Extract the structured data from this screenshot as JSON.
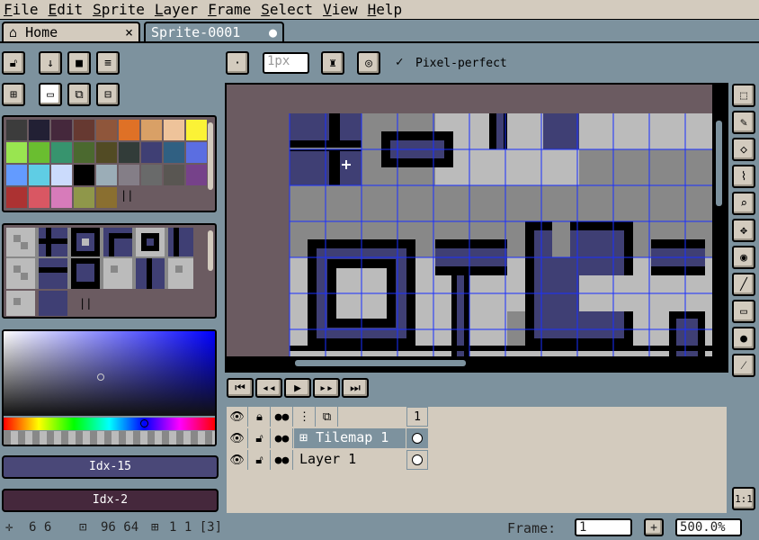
{
  "menu": [
    "File",
    "Edit",
    "Sprite",
    "Layer",
    "Frame",
    "Select",
    "View",
    "Help"
  ],
  "tabs": {
    "home": {
      "label": "Home",
      "close": "×"
    },
    "sprite": {
      "label": "Sprite-0001",
      "modified": "●"
    }
  },
  "toolbar": {
    "brush_size": "1px",
    "pixel_perfect_label": "Pixel-perfect",
    "pixel_perfect_checked": true
  },
  "palette": {
    "colors": [
      "#3c3c3c",
      "#222034",
      "#45283c",
      "#663931",
      "#8f563b",
      "#df7126",
      "#d9a066",
      "#eec39a",
      "#fbf236",
      "#99e550",
      "#6abe30",
      "#37946e",
      "#4b692f",
      "#524b24",
      "#323c39",
      "#3f3f74",
      "#306082",
      "#5b6ee1",
      "#639bff",
      "#5fcde4",
      "#cbdbfc",
      "#000000",
      "#9badb7",
      "#847e87",
      "#696a6a",
      "#595652",
      "#76428a",
      "#ac3232",
      "#d95763",
      "#d77bba",
      "#8f974a",
      "#8a6f30"
    ],
    "more": "||"
  },
  "tileset_more": "||",
  "color_bar": {
    "fg_label": "Idx-15",
    "bg_label": "Idx-2",
    "fg_color": "#4a4878",
    "bg_color": "#45283c"
  },
  "timeline": {
    "frame_number": "1",
    "layers": [
      {
        "name": "Tilemap 1",
        "icon": "⊞"
      },
      {
        "name": "Layer 1",
        "icon": ""
      }
    ]
  },
  "status": {
    "cursor": "6 6",
    "size": "96 64",
    "grid": "1 1 [3]",
    "frame_label": "Frame:",
    "frame_value": "1",
    "zoom": "500.0%"
  },
  "zoom_button": "1:1"
}
